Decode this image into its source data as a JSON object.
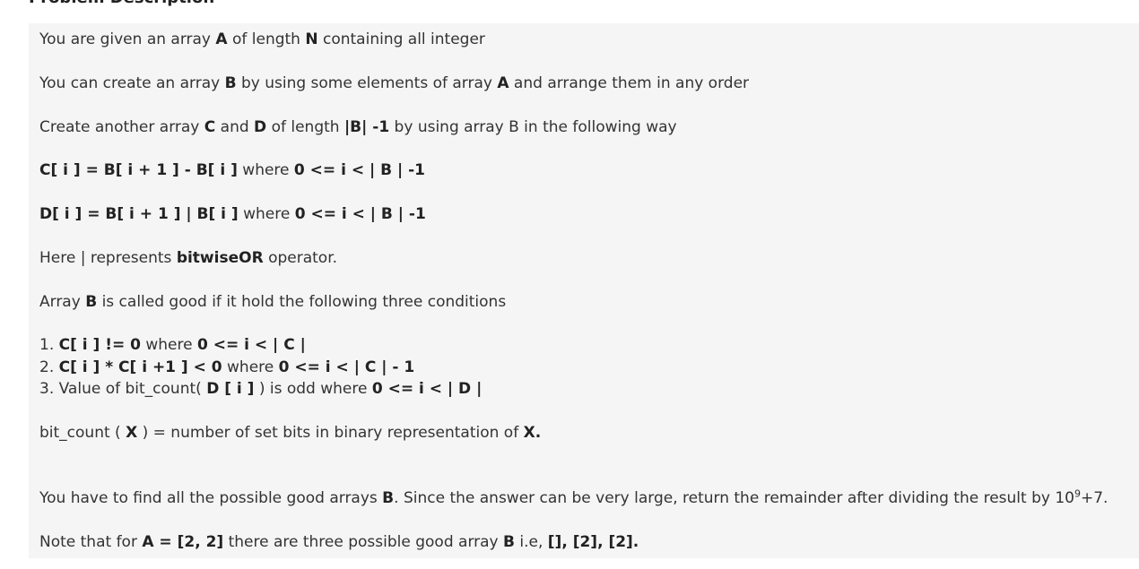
{
  "heading": "Problem Description",
  "lines": [
    {
      "id": "l1",
      "segments": [
        {
          "t": "You are given an array "
        },
        {
          "t": "A",
          "b": true
        },
        {
          "t": " of length "
        },
        {
          "t": "N",
          "b": true
        },
        {
          "t": " containing all integer"
        }
      ]
    },
    {
      "id": "l2",
      "segments": [
        {
          "t": "You can create an array "
        },
        {
          "t": "B",
          "b": true
        },
        {
          "t": " by using some elements of array "
        },
        {
          "t": "A",
          "b": true
        },
        {
          "t": " and arrange them in any order"
        }
      ]
    },
    {
      "id": "l3",
      "segments": [
        {
          "t": "Create another array "
        },
        {
          "t": "C",
          "b": true
        },
        {
          "t": " and "
        },
        {
          "t": "D",
          "b": true
        },
        {
          "t": " of length "
        },
        {
          "t": "|B| -1",
          "b": true
        },
        {
          "t": " by using array B in the following way"
        }
      ]
    },
    {
      "id": "l4",
      "segments": [
        {
          "t": "C[ i ] = B[ i + 1 ] - B[ i ]",
          "b": true
        },
        {
          "t": " where "
        },
        {
          "t": "0 <= i < | B | -1",
          "b": true
        }
      ]
    },
    {
      "id": "l5",
      "segments": [
        {
          "t": "D[ i ] = B[ i + 1 ] | B[ i ]",
          "b": true
        },
        {
          "t": " where "
        },
        {
          "t": "0 <= i < | B | -1",
          "b": true
        }
      ]
    },
    {
      "id": "l6",
      "segments": [
        {
          "t": "Here | represents "
        },
        {
          "t": "bitwiseOR",
          "b": true
        },
        {
          "t": " operator."
        }
      ]
    },
    {
      "id": "l7",
      "segments": [
        {
          "t": "Array "
        },
        {
          "t": "B",
          "b": true
        },
        {
          "t": " is called good if it hold the following three conditions"
        }
      ]
    },
    {
      "id": "c1",
      "segments": [
        {
          "t": "1. "
        },
        {
          "t": "C[ i ] != 0",
          "b": true
        },
        {
          "t": " where "
        },
        {
          "t": "0 <= i < | C |",
          "b": true
        }
      ]
    },
    {
      "id": "c2",
      "segments": [
        {
          "t": "2. "
        },
        {
          "t": "C[ i ] * C[ i +1 ] < 0",
          "b": true
        },
        {
          "t": " where "
        },
        {
          "t": "0 <= i < | C | - 1",
          "b": true
        }
      ]
    },
    {
      "id": "c3",
      "segments": [
        {
          "t": "3. Value of bit_count( "
        },
        {
          "t": "D [ i ]",
          "b": true
        },
        {
          "t": " ) is odd where "
        },
        {
          "t": "0 <= i < | D |",
          "b": true
        }
      ]
    },
    {
      "id": "l8",
      "segments": [
        {
          "t": "bit_count ( "
        },
        {
          "t": "X",
          "b": true
        },
        {
          "t": " ) = number of set bits in binary representation of "
        },
        {
          "t": "X.",
          "b": true
        }
      ]
    },
    {
      "id": "l9",
      "segments": [
        {
          "t": "You have to find all the possible good arrays "
        },
        {
          "t": "B",
          "b": true
        },
        {
          "t": ". Since the answer can be very large, return the remainder after dividing the result by 10"
        },
        {
          "t": "9",
          "sup": true
        },
        {
          "t": "+7."
        }
      ]
    },
    {
      "id": "l10",
      "segments": [
        {
          "t": "Note that for "
        },
        {
          "t": "A = [2, 2]",
          "b": true
        },
        {
          "t": " there are three possible good array "
        },
        {
          "t": "B",
          "b": true
        },
        {
          "t": " i.e, "
        },
        {
          "t": "[], [2], [2].",
          "b": true
        }
      ]
    }
  ]
}
